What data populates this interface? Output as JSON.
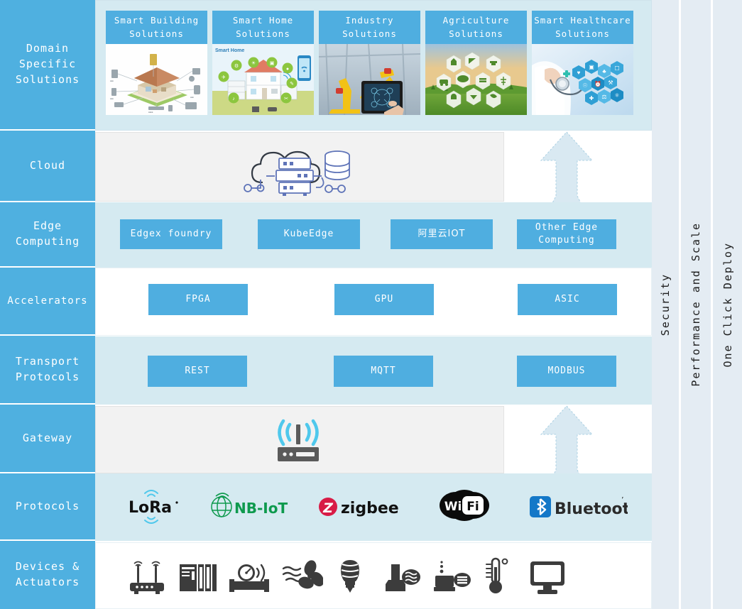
{
  "layers": [
    {
      "key": "domain",
      "label": "Domain\nSpecific\nSolutions"
    },
    {
      "key": "cloud",
      "label": "Cloud"
    },
    {
      "key": "edge",
      "label": "Edge\nComputing"
    },
    {
      "key": "accel",
      "label": "Accelerators"
    },
    {
      "key": "transport",
      "label": "Transport\nProtocols"
    },
    {
      "key": "gateway",
      "label": "Gateway"
    },
    {
      "key": "protocols",
      "label": "Protocols"
    },
    {
      "key": "devices",
      "label": "Devices &\nActuators"
    }
  ],
  "domain_cards": [
    {
      "title": "Smart Building\nSolutions",
      "art": "smart-building-illustration"
    },
    {
      "title": "Smart Home\nSolutions",
      "art": "smart-home-illustration",
      "art_label": "Smart Home"
    },
    {
      "title": "Industry\nSolutions",
      "art": "industrial-robot-photo"
    },
    {
      "title": "Agriculture\nSolutions",
      "art": "agriculture-hexagon-photo"
    },
    {
      "title": "Smart Healthcare\nSolutions",
      "art": "healthcare-hexagon-photo"
    }
  ],
  "cloud": {
    "icon": "cloud-server-database-icon"
  },
  "edge_items": [
    {
      "label": "Edgex foundry"
    },
    {
      "label": "KubeEdge"
    },
    {
      "label": "阿里云IOT"
    },
    {
      "label": "Other Edge\nComputing"
    }
  ],
  "accelerators": [
    {
      "label": "FPGA"
    },
    {
      "label": "GPU"
    },
    {
      "label": "ASIC"
    }
  ],
  "transport_protocols": [
    {
      "label": "REST"
    },
    {
      "label": "MQTT"
    },
    {
      "label": "MODBUS"
    }
  ],
  "gateway": {
    "icon": "wireless-router-icon"
  },
  "protocols": [
    {
      "name": "LoRa",
      "text": "LoRa",
      "icon": "lora-logo",
      "color": "#111111",
      "accent": "#4FC8EC"
    },
    {
      "name": "NB-IoT",
      "text": "NB-IoT",
      "icon": "nbiot-logo",
      "color": "#0E9A4E",
      "accent": "#0E9A4E"
    },
    {
      "name": "zigbee",
      "text": "zigbee",
      "icon": "zigbee-logo",
      "color": "#111111",
      "accent": "#D81B46"
    },
    {
      "name": "WiFi",
      "text": "Wi Fi",
      "icon": "wifi-logo",
      "color": "#ffffff",
      "accent": "#0b0b0b"
    },
    {
      "name": "Bluetooth",
      "text": "Bluetooth",
      "icon": "bluetooth-logo",
      "color": "#2b2b2b",
      "accent": "#1478C8"
    }
  ],
  "devices": [
    {
      "icon": "wireless-router-device-icon"
    },
    {
      "icon": "plc-controller-icon"
    },
    {
      "icon": "flow-meter-icon"
    },
    {
      "icon": "air-blower-fan-icon"
    },
    {
      "icon": "light-bulb-icon"
    },
    {
      "icon": "pressure-sensor-icon"
    },
    {
      "icon": "level-sensor-icon"
    },
    {
      "icon": "thermometer-icon"
    },
    {
      "icon": "monitor-display-icon"
    }
  ],
  "vertical_columns": [
    {
      "label": "Security"
    },
    {
      "label": "Performance and  Scale"
    },
    {
      "label": "One Click Deploy"
    }
  ],
  "arrows": [
    {
      "name": "upward-arrow-edge"
    },
    {
      "name": "upward-arrow-gateway"
    }
  ],
  "colors": {
    "brand_blue": "#4FAEE0",
    "label_blue": "#4FB0E0",
    "panel_cyan": "#D5EAF1",
    "panel_gray": "#F2F2F2",
    "strip_blue": "#E4ECF3",
    "arrow_fill": "#D9E9F2"
  }
}
